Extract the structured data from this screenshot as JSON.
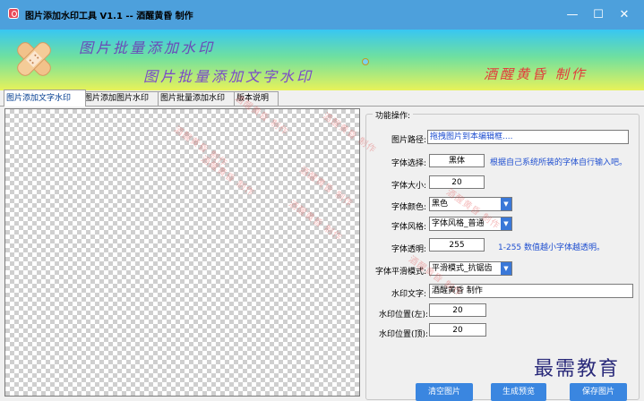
{
  "window": {
    "title": "图片添加水印工具 V1.1 -- 酒醒黄昏 制作",
    "minimize_glyph": "—",
    "maximize_glyph": "☐",
    "close_glyph": "✕"
  },
  "banner": {
    "line1": "图片批量添加水印",
    "line2": "图片批量添加文字水印",
    "credit": "酒醒黄昏 制作",
    "logo_icon": "crossed-bandage-icon"
  },
  "tabs": [
    {
      "label": "图片添加文字水印",
      "active": true
    },
    {
      "label": "图片添加图片水印",
      "active": false
    },
    {
      "label": "图片批量添加水印",
      "active": false
    },
    {
      "label": "版本说明",
      "active": false
    }
  ],
  "form": {
    "legend": "功能操作:",
    "image_path": {
      "label": "图片路径:",
      "placeholder": "拖拽图片到本编辑框...."
    },
    "font_name": {
      "label": "字体选择:",
      "value": "黑体",
      "hint": "根据自己系统所装的字体自行输入吧。"
    },
    "font_size": {
      "label": "字体大小:",
      "value": "20"
    },
    "font_color": {
      "label": "字体颜色:",
      "value": "黑色"
    },
    "font_style": {
      "label": "字体风格:",
      "value": "字体风格_普通"
    },
    "opacity": {
      "label": "字体透明:",
      "value": "255",
      "hint": "1-255  数值越小字体越透明。"
    },
    "smoothing": {
      "label": "字体平滑模式:",
      "value": "平滑模式_抗锯齿"
    },
    "watermark_text": {
      "label": "水印文字:",
      "value": "酒醒黄昏 制作"
    },
    "position_left": {
      "label": "水印位置(左):",
      "value": "20"
    },
    "position_top": {
      "label": "水印位置(顶):",
      "value": "20"
    }
  },
  "buttons": {
    "clear": "清空图片",
    "generate": "生成预览",
    "save": "保存图片"
  },
  "overlay_watermark_text": "酒醒黄昏 制作",
  "brand_watermark": "最需教育",
  "colors": {
    "titlebar": "#4da0dc",
    "button": "#3a86e0",
    "hint": "#1f4fd0",
    "credit": "#e23c3c"
  }
}
